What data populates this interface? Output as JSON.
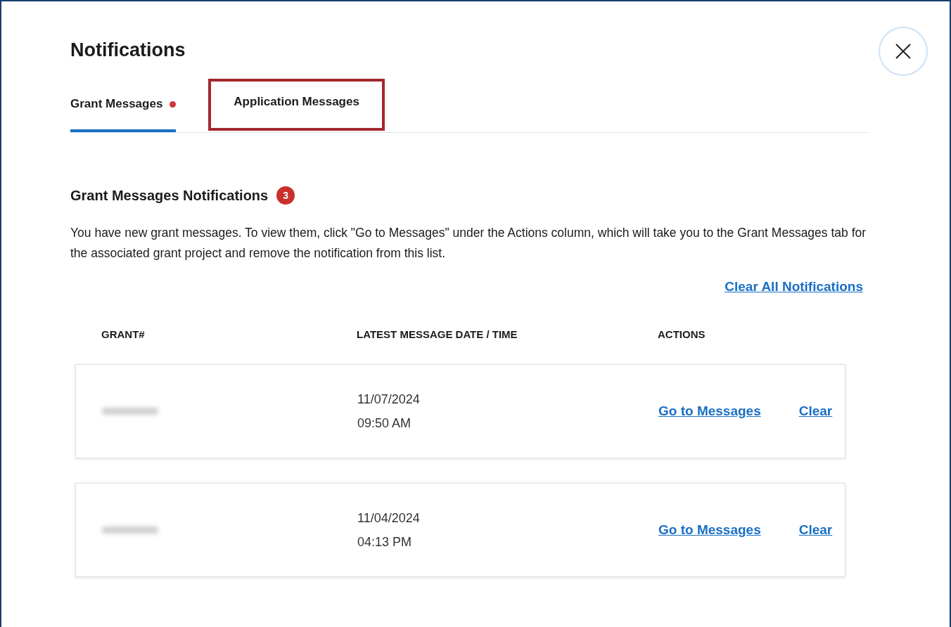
{
  "title": "Notifications",
  "tabs": [
    {
      "label": "Grant Messages",
      "selected": true,
      "has_new": true,
      "highlighted": false
    },
    {
      "label": "Application Messages",
      "selected": false,
      "has_new": false,
      "highlighted": true
    }
  ],
  "section": {
    "heading": "Grant Messages Notifications",
    "count": "3",
    "description": "You have new grant messages. To view them, click \"Go to Messages\" under the Actions column, which will take you to the Grant Messages tab for the associated grant project and remove the notification from this list."
  },
  "clear_all": "Clear All Notifications",
  "table": {
    "columns": [
      "GRANT#",
      "LATEST MESSAGE DATE / TIME",
      "ACTIONS"
    ],
    "rows": [
      {
        "grant_blurred": true,
        "date": "11/07/2024",
        "time": "09:50 AM",
        "actions": [
          "Go to Messages",
          "Clear"
        ]
      },
      {
        "grant_blurred": true,
        "date": "11/04/2024",
        "time": "04:13 PM",
        "actions": [
          "Go to Messages",
          "Clear"
        ]
      }
    ]
  }
}
